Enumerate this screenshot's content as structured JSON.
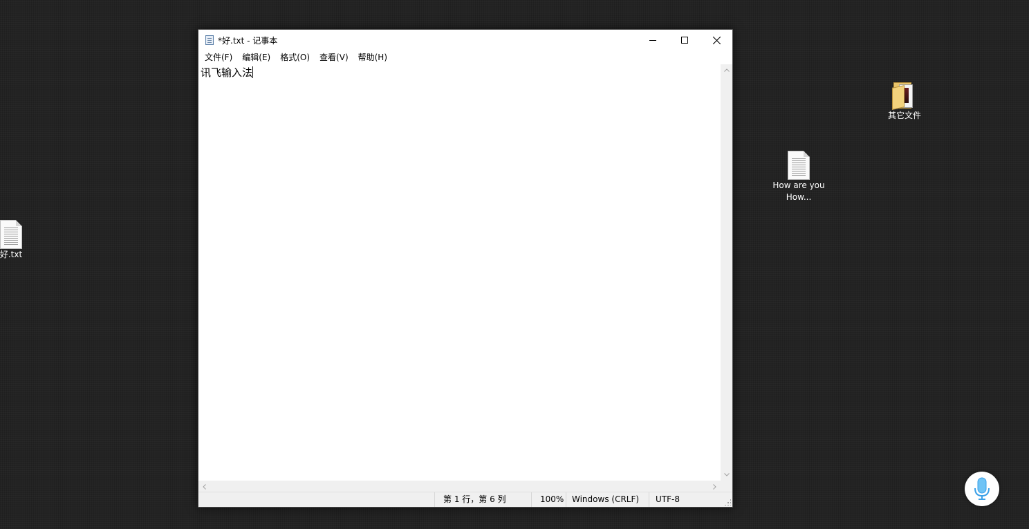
{
  "desktop": {
    "icons": [
      {
        "label": "好.txt"
      },
      {
        "label": "其它文件"
      },
      {
        "label": "How are you How..."
      }
    ]
  },
  "window": {
    "title": "*好.txt - 记事本",
    "controls": {
      "minimize": "minimize-icon",
      "maximize": "maximize-icon",
      "close": "close-icon"
    }
  },
  "menu": {
    "items": [
      "文件(F)",
      "编辑(E)",
      "格式(O)",
      "查看(V)",
      "帮助(H)"
    ]
  },
  "editor": {
    "content": "讯飞输入法"
  },
  "statusbar": {
    "position": "第 1 行，第 6 列",
    "zoom": "100%",
    "line_ending": "Windows (CRLF)",
    "encoding": "UTF-8"
  },
  "mic_button": {
    "icon": "microphone-icon",
    "accent": "#3aa0e8"
  }
}
